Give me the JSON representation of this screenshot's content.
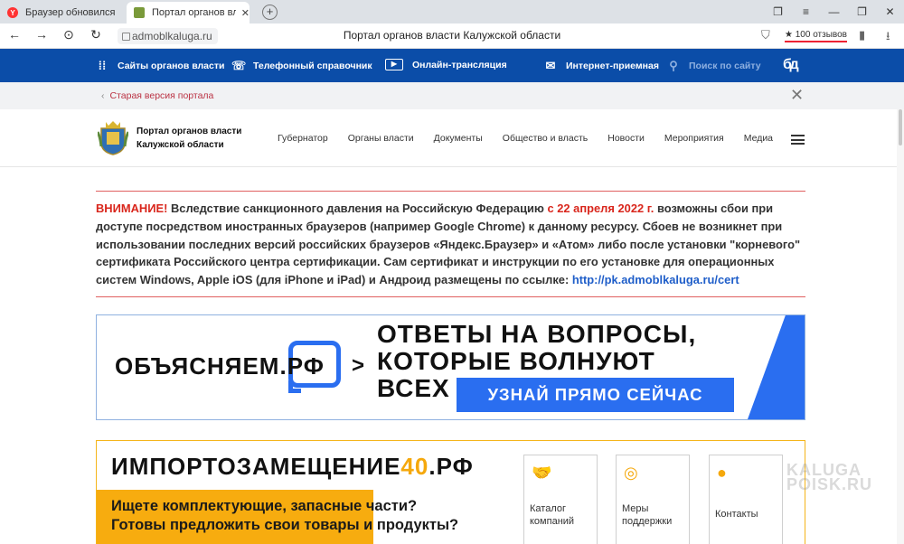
{
  "browser": {
    "tabs": [
      {
        "label": "Браузер обновился"
      },
      {
        "label": "Портал органов власти Калужской области"
      }
    ],
    "new_tab": "+",
    "url": "admoblkaluga.ru",
    "page_title": "Портал органов власти Калужской области",
    "reviews": "★ 100 отзывов"
  },
  "topnav": {
    "items": [
      {
        "label": "Сайты органов власти",
        "icon": "grid-icon"
      },
      {
        "label": "Телефонный справочник",
        "icon": "phone-book-icon"
      },
      {
        "label": "Онлайн-трансляция",
        "icon": "play-icon"
      },
      {
        "label": "Интернет-приемная",
        "icon": "mail-icon"
      }
    ],
    "search_placeholder": "Поиск по сайту",
    "accessibility_icon": "бд"
  },
  "oldversion": {
    "label": "Старая версия портала"
  },
  "header": {
    "site_name_line1": "Портал органов власти",
    "site_name_line2": "Калужской области",
    "menu": [
      "Губернатор",
      "Органы власти",
      "Документы",
      "Общество и власть",
      "Новости",
      "Мероприятия",
      "Медиа"
    ]
  },
  "warning": {
    "attention": "ВНИМАНИЕ!",
    "part1": " Вследствие санкционного давления на Российскую Федерацию ",
    "date": "с 22 апреля 2022 г.",
    "part2": " возможны сбои при доступе посредством иностранных браузеров (например Google Chrome) к данному ресурсу. Сбоев не возникнет при использовании последних версий российских браузеров «Яндекс.Браузер» и «Атом» либо после установки \"корневого\" сертификата Российского центра сертификации. Сам сертификат и инструкции по его установке для операционных систем Windows, Apple iOS (для iPhone и iPad) и Андроид размещены по ссылке: ",
    "link": "http://pk.admoblkaluga.ru/cert"
  },
  "banner1": {
    "brand": "ОБЪЯСНЯЕМ.РФ",
    "arrow": ">",
    "line1": "ОТВЕТЫ НА ВОПРОСЫ,",
    "line2": "КОТОРЫЕ ВОЛНУЮТ",
    "line3": "ВСЕХ",
    "cta": "УЗНАЙ ПРЯМО СЕЙЧАС"
  },
  "banner2": {
    "title_main": "ИМПОРТОЗАМЕЩЕНИЕ",
    "title_accent": "40",
    "title_suffix": ".РФ",
    "line1": "Ищете комплектующие, запасные части?",
    "line2": "Готовы предложить свои товары и продукты?",
    "cards": [
      {
        "line1": "Каталог",
        "line2": "компаний",
        "icon": "handshake-icon"
      },
      {
        "line1": "Меры",
        "line2": "поддержки",
        "icon": "lifebuoy-icon"
      },
      {
        "line1": "Контакты",
        "line2": "",
        "icon": "person-icon"
      }
    ]
  },
  "watermark": {
    "line1": "KALUGA",
    "line2": "POISK.RU"
  }
}
